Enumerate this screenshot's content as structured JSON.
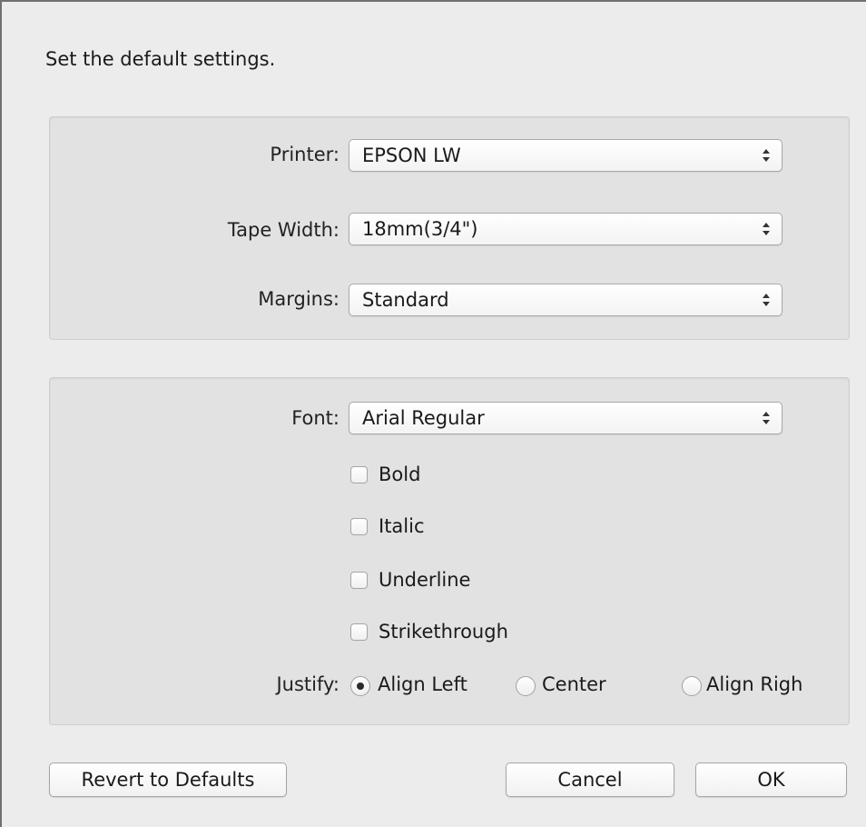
{
  "dialog": {
    "heading": "Set the default settings."
  },
  "printer_settings": {
    "printer": {
      "label": "Printer:",
      "value": "EPSON LW"
    },
    "tape_width": {
      "label": "Tape Width:",
      "value": "18mm(3/4\")"
    },
    "margins": {
      "label": "Margins:",
      "value": "Standard"
    }
  },
  "font_settings": {
    "font": {
      "label": "Font:",
      "value": "Arial Regular"
    },
    "styles": [
      {
        "label": "Bold",
        "checked": false
      },
      {
        "label": "Italic",
        "checked": false
      },
      {
        "label": "Underline",
        "checked": false
      },
      {
        "label": "Strikethrough",
        "checked": false
      }
    ],
    "justify": {
      "label": "Justify:",
      "options": [
        {
          "label": "Align Left",
          "selected": true
        },
        {
          "label": "Center",
          "selected": false
        },
        {
          "label": "Align Righ",
          "selected": false
        }
      ]
    }
  },
  "buttons": {
    "revert": "Revert to Defaults",
    "cancel": "Cancel",
    "ok": "OK"
  }
}
